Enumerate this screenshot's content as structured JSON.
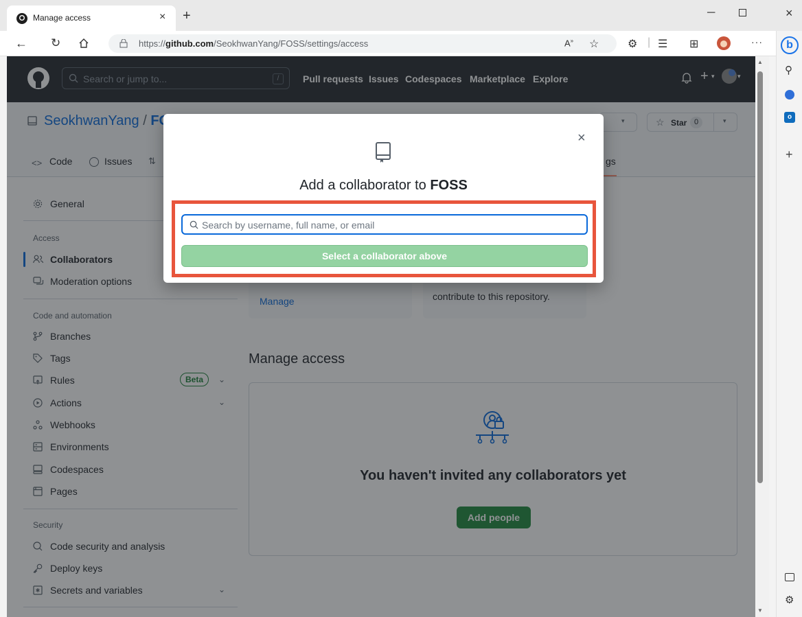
{
  "browser": {
    "tab_title": "Manage access",
    "url_prefix": "https://",
    "url_domain": "github.com",
    "url_path": "/SeokhwanYang/FOSS/settings/access"
  },
  "github": {
    "search_placeholder": "Search or jump to...",
    "search_shortcut": "/",
    "nav": [
      "Pull requests",
      "Issues",
      "Codespaces",
      "Marketplace",
      "Explore"
    ]
  },
  "repo": {
    "owner": "SeokhwanYang",
    "slash": "/",
    "name_partial": "FO",
    "star_label": "Star",
    "star_count": "0",
    "tabs": {
      "code": "Code",
      "issues": "Issues",
      "settings_partial": "gs"
    }
  },
  "sidebar": {
    "general": "General",
    "access_heading": "Access",
    "collaborators": "Collaborators",
    "moderation": "Moderation options",
    "code_heading": "Code and automation",
    "branches": "Branches",
    "tags": "Tags",
    "rules": "Rules",
    "rules_badge": "Beta",
    "actions": "Actions",
    "webhooks": "Webhooks",
    "environments": "Environments",
    "codespaces": "Codespaces",
    "pages": "Pages",
    "security_heading": "Security",
    "code_security": "Code security and analysis",
    "deploy_keys": "Deploy keys",
    "secrets": "Secrets and variables"
  },
  "main": {
    "card_left_link": "Manage",
    "card_right_text": "contribute to this repository.",
    "section_title": "Manage access",
    "empty_title": "You haven't invited any collaborators yet",
    "add_people": "Add people"
  },
  "dialog": {
    "title_prefix": "Add a collaborator to ",
    "title_repo": "FOSS",
    "close": "×",
    "search_placeholder": "Search by username, full name, or email",
    "select_button": "Select a collaborator above"
  },
  "colors": {
    "github_header": "#24292f",
    "accent_blue": "#0969da",
    "green": "#1f883d",
    "green_disabled": "#94d3a2",
    "highlight_red": "#e8553c"
  }
}
